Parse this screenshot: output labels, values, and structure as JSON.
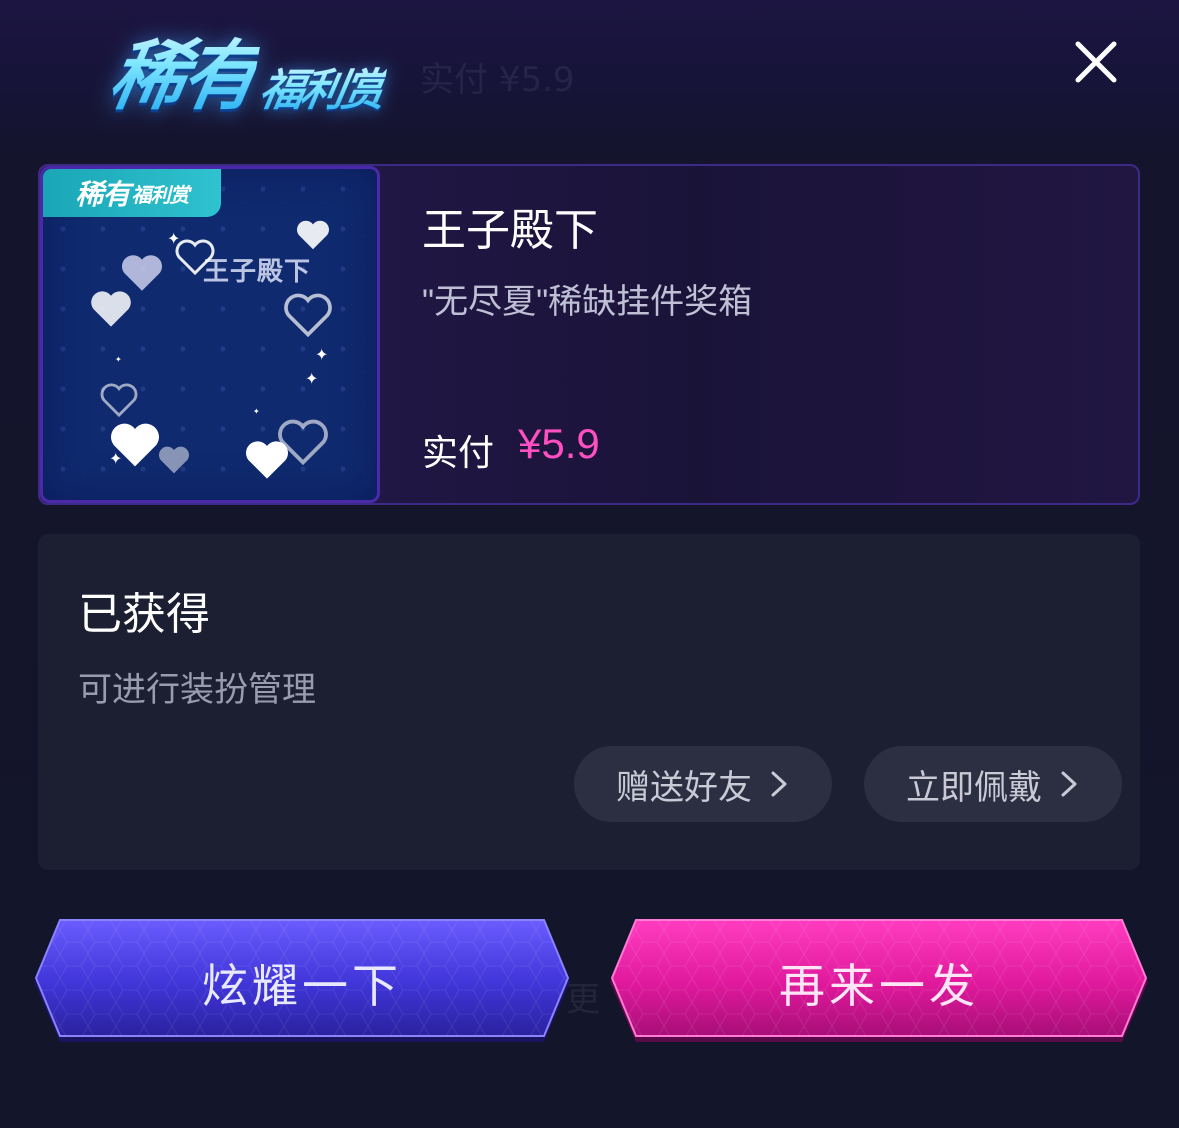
{
  "header": {
    "logo_main": "稀有",
    "logo_sub": "福利赏",
    "close_icon": "close-icon"
  },
  "prize": {
    "tag_main": "稀有",
    "tag_sub": "福利赏",
    "thumb_name": "王子殿下",
    "title": "王子殿下",
    "description": "\"无尽夏\"稀缺挂件奖箱",
    "paid_label": "实付",
    "price": "¥5.9",
    "price_color": "#ff4fc0"
  },
  "obtained": {
    "title": "已获得",
    "subtitle": "可进行装扮管理",
    "gift_label": "赠送好友",
    "wear_label": "立即佩戴"
  },
  "actions": {
    "show_off_label": "炫耀一下",
    "again_label": "再来一发",
    "show_off_color": "#4b3ee0",
    "again_color": "#e0199c"
  }
}
